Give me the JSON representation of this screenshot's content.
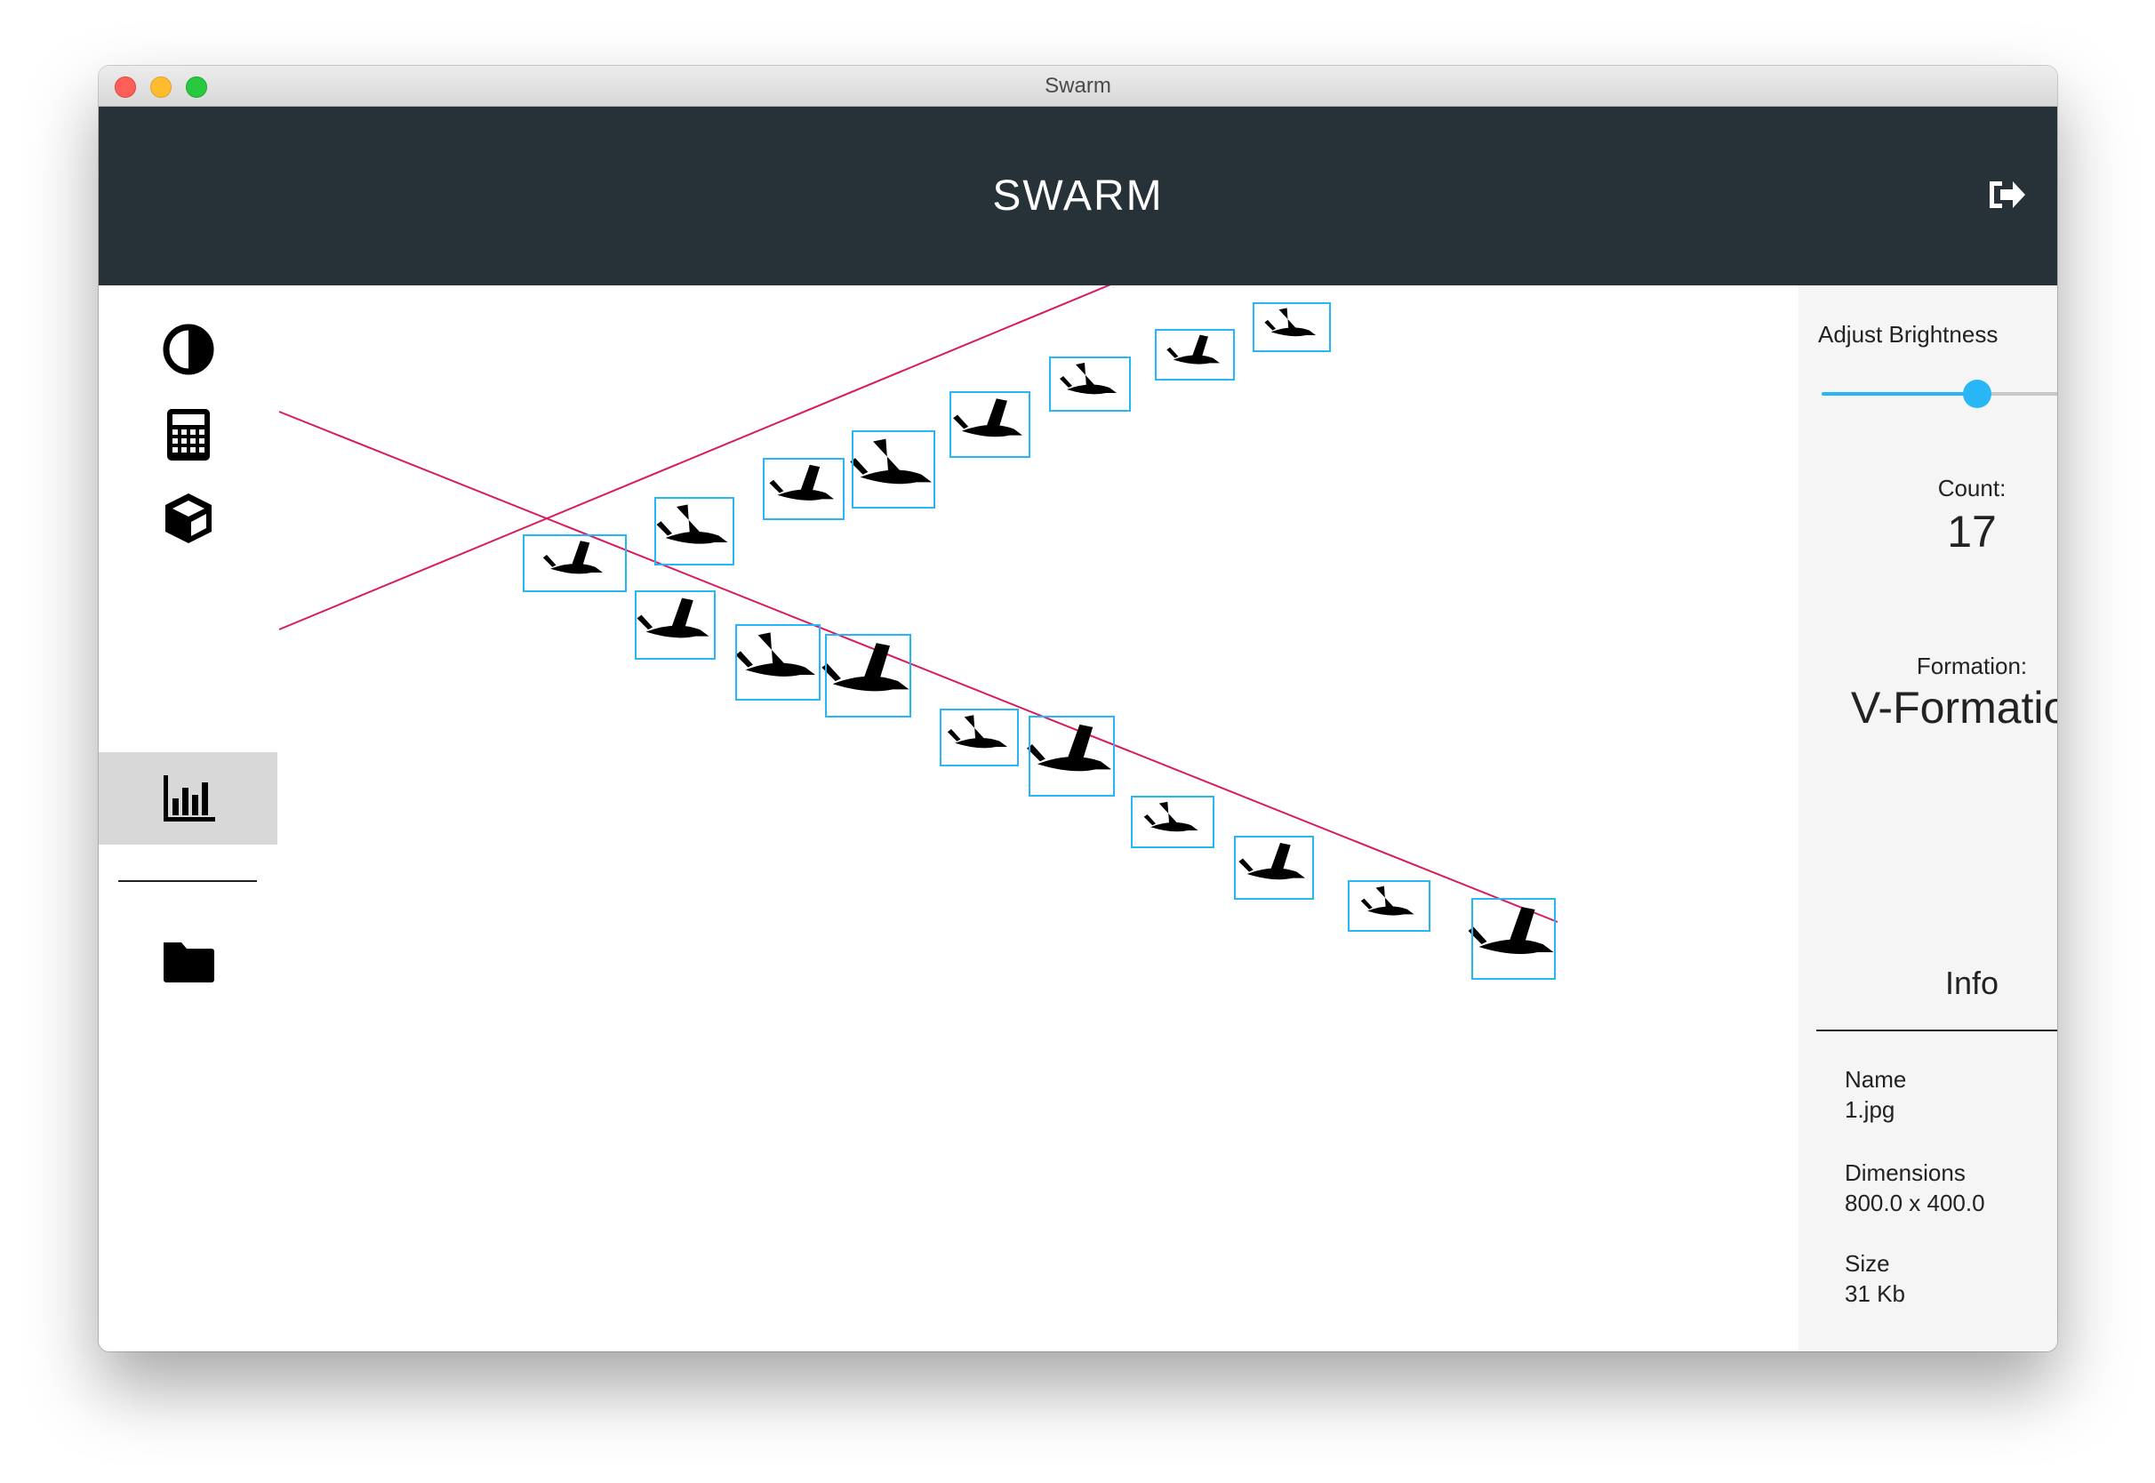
{
  "window": {
    "title": "Swarm"
  },
  "header": {
    "title": "SWARM",
    "logout_icon": "sign-out-icon"
  },
  "sidebar": {
    "items": [
      {
        "icon": "contrast-icon"
      },
      {
        "icon": "calculator-icon"
      },
      {
        "icon": "cube-icon"
      },
      {
        "icon": "bar-chart-icon",
        "active": true
      },
      {
        "icon": "folder-icon"
      }
    ]
  },
  "canvas": {
    "box_color": "#29b6f6",
    "line_color": "#d81b60"
  },
  "panel": {
    "brightness_label": "Adjust Brightness",
    "brightness_value": 0.5,
    "count_label": "Count:",
    "count_value": "17",
    "formation_label": "Formation:",
    "formation_value": "V-Formation",
    "info_title": "Info",
    "info": [
      {
        "key": "Name",
        "value": "1.jpg"
      },
      {
        "key": "Dimensions",
        "value": "800.0 x 400.0"
      },
      {
        "key": "Size",
        "value": "31 Kb"
      }
    ]
  },
  "colors": {
    "appbar": "#263238",
    "accent": "#29b6f6"
  }
}
